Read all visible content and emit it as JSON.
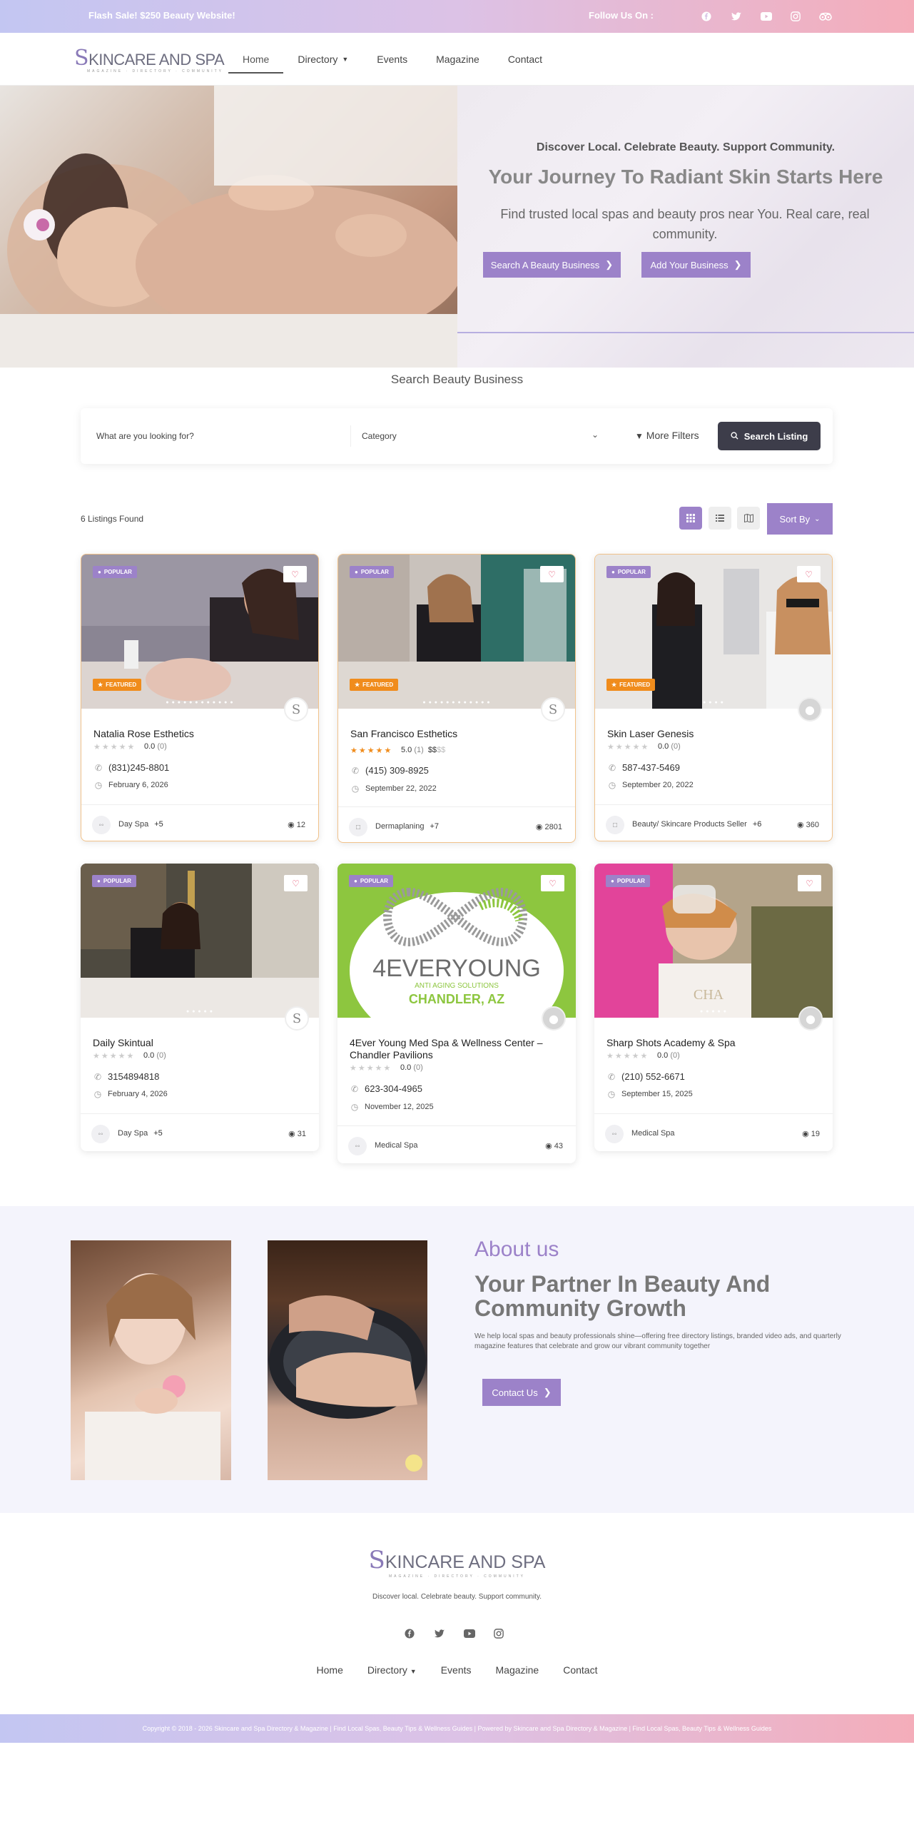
{
  "topbar": {
    "flash": "Flash Sale! $250 Beauty Website!",
    "follow": "Follow Us On :",
    "social_icons": [
      "facebook-icon",
      "twitter-icon",
      "youtube-icon",
      "instagram-icon",
      "tripadvisor-icon"
    ]
  },
  "header": {
    "logo_main": "KINCARE AND SPA",
    "logo_s": "S",
    "logo_sub": "MAGAZINE · DIRECTORY · COMMUNITY",
    "nav": [
      "Home",
      "Directory",
      "Events",
      "Magazine",
      "Contact"
    ]
  },
  "hero": {
    "tagline": "Discover Local. Celebrate Beauty. Support Community.",
    "title": "Your Journey To Radiant Skin Starts Here",
    "subtitle": "Find trusted local spas and beauty pros near You. Real care, real community.",
    "btn_search": "Search A Beauty Business",
    "btn_add": "Add Your Business"
  },
  "search": {
    "title": "Search Beauty Business",
    "query_placeholder": "What are you looking for?",
    "category": "Category",
    "more_filters": "More Filters",
    "button": "Search Listing"
  },
  "listings_bar": {
    "found": "6 Listings Found",
    "sort": "Sort By"
  },
  "badges": {
    "popular": "POPULAR",
    "featured": "FEATURED"
  },
  "listings": [
    {
      "name": "Natalia Rose Esthetics",
      "rating": "0.0",
      "count": "(0)",
      "price": "",
      "price_dim": "",
      "phone": "(831)245-8801",
      "date": "February 6, 2026",
      "category": "Day Spa",
      "more": "+5",
      "views": "12"
    },
    {
      "name": "San Francisco Esthetics",
      "rating": "5.0",
      "count": "(1)",
      "price": "$$",
      "price_dim": "$$",
      "phone": "(415) 309-8925",
      "date": "September 22, 2022",
      "category": "Dermaplaning",
      "more": "+7",
      "views": "2801"
    },
    {
      "name": "Skin Laser Genesis",
      "rating": "0.0",
      "count": "(0)",
      "price": "",
      "price_dim": "",
      "phone": "587-437-5469",
      "date": "September 20, 2022",
      "category": "Beauty/ Skincare Products Seller",
      "more": "+6",
      "views": "360"
    },
    {
      "name": "Daily Skintual",
      "rating": "0.0",
      "count": "(0)",
      "price": "",
      "price_dim": "",
      "phone": "3154894818",
      "date": "February 4, 2026",
      "category": "Day Spa",
      "more": "+5",
      "views": "31"
    },
    {
      "name": "4Ever Young Med Spa & Wellness Center – Chandler Pavilions",
      "rating": "0.0",
      "count": "(0)",
      "price": "",
      "price_dim": "",
      "phone": "623-304-4965",
      "date": "November 12, 2025",
      "category": "Medical Spa",
      "more": "",
      "views": "43"
    },
    {
      "name": "Sharp Shots Academy & Spa",
      "rating": "0.0",
      "count": "(0)",
      "price": "",
      "price_dim": "",
      "phone": "(210) 552-6671",
      "date": "September 15, 2025",
      "category": "Medical Spa",
      "more": "",
      "views": "19"
    }
  ],
  "card_images": {
    "img5_line1": "4EVERYOUNG",
    "img5_line2": "ANTI AGING SOLUTIONS",
    "img5_line3": "CHANDLER, AZ"
  },
  "about": {
    "label": "About us",
    "title": "Your Partner In Beauty And Community Growth",
    "text": "We help local spas and beauty professionals shine—offering free directory listings, branded video ads, and quarterly magazine features that celebrate and grow our vibrant community together",
    "button": "Contact Us"
  },
  "footer": {
    "tagline": "Discover local. Celebrate beauty. Support community.",
    "nav": [
      "Home",
      "Directory",
      "Events",
      "Magazine",
      "Contact"
    ],
    "copyright": "Copyright © 2018 - 2026 Skincare and Spa Directory & Magazine | Find Local Spas, Beauty Tips & Wellness Guides | Powered by Skincare and Spa Directory & Magazine | Find Local Spas, Beauty Tips & Wellness Guides"
  },
  "colors": {
    "accent": "#9c82c9",
    "featured": "#f08c1c",
    "dark_button": "#3d3d4a"
  }
}
